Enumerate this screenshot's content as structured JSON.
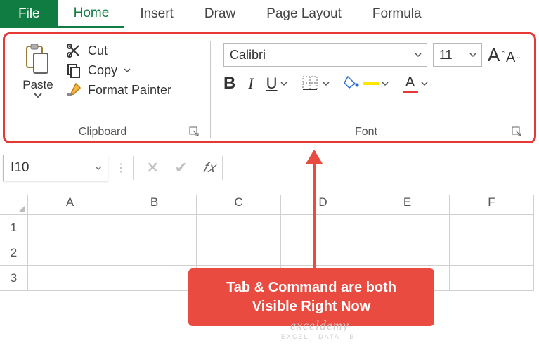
{
  "tabs": {
    "file": "File",
    "home": "Home",
    "insert": "Insert",
    "draw": "Draw",
    "pagelayout": "Page Layout",
    "formula": "Formula"
  },
  "clipboard": {
    "paste": "Paste",
    "cut": "Cut",
    "copy": "Copy",
    "formatpainter": "Format Painter",
    "group_label": "Clipboard"
  },
  "font": {
    "name": "Calibri",
    "size": "11",
    "bold": "B",
    "italic": "I",
    "underline": "U",
    "fontcolor_letter": "A",
    "grow_a": "A",
    "shrink_a": "A",
    "group_label": "Font"
  },
  "namebox": {
    "value": "I10"
  },
  "formula_fx": "𝑓𝑥",
  "columns": [
    "A",
    "B",
    "C",
    "D",
    "E",
    "F"
  ],
  "rows": [
    "1",
    "2",
    "3"
  ],
  "callout": {
    "line1": "Tab & Command are both",
    "line2": "Visible Right Now"
  },
  "watermark": {
    "brand": "exceldemy",
    "tag": "EXCEL · DATA · BI"
  }
}
